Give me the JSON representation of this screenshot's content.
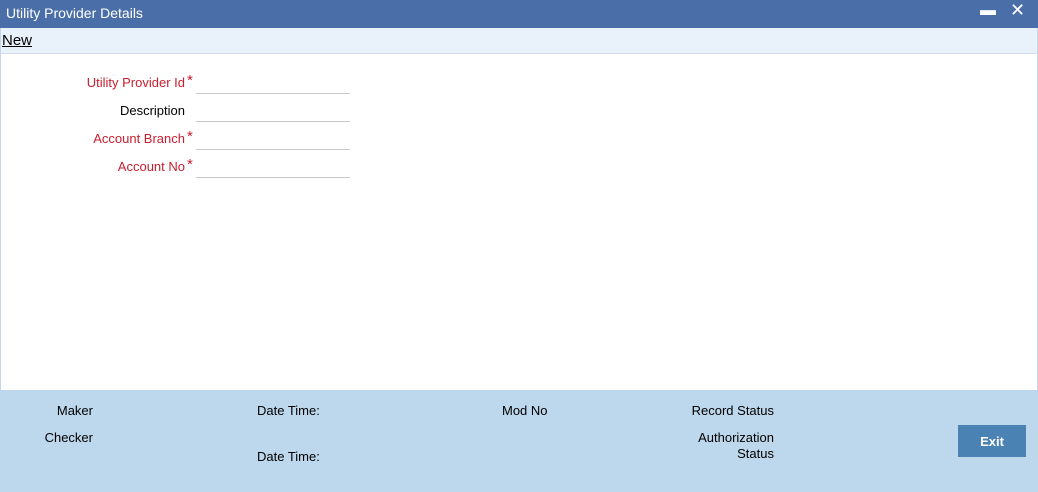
{
  "window": {
    "title": "Utility Provider Details",
    "minimize_glyph": "▬",
    "close_glyph": "✕"
  },
  "toolbar": {
    "new_label": "New"
  },
  "form": {
    "fields": [
      {
        "label": "Utility Provider Id",
        "required": true,
        "value": ""
      },
      {
        "label": "Description",
        "required": false,
        "value": ""
      },
      {
        "label": "Account Branch",
        "required": true,
        "value": ""
      },
      {
        "label": "Account No",
        "required": true,
        "value": ""
      }
    ],
    "required_marker": "*"
  },
  "footer": {
    "maker_label": "Maker",
    "checker_label": "Checker",
    "date_time_label_1": "Date Time:",
    "date_time_label_2": "Date Time:",
    "mod_no_label": "Mod No",
    "record_status_label": "Record Status",
    "authorization_status_line1": "Authorization",
    "authorization_status_line2": "Status",
    "exit_label": "Exit"
  },
  "colors": {
    "titlebar": "#4a6fa8",
    "required_text": "#c81e2e",
    "footer_bg": "#bdd7ec",
    "exit_button": "#4a82b4"
  }
}
